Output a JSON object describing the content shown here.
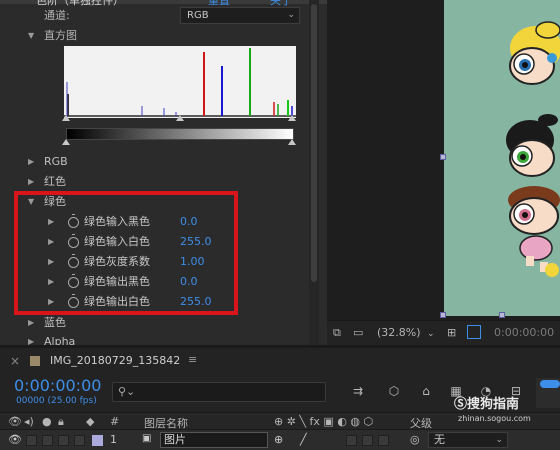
{
  "effect_panel": {
    "header_title": "色阶（单独控件）",
    "header_link": "重置",
    "header_about": "关于",
    "channel_label": "通道:",
    "channel_value": "RGB",
    "histogram_label": "直方图",
    "sections": [
      "RGB",
      "红色",
      "绿色"
    ],
    "green_props": [
      {
        "label": "绿色输入黑色",
        "value": "0.0"
      },
      {
        "label": "绿色输入白色",
        "value": "255.0"
      },
      {
        "label": "绿色灰度系数",
        "value": "1.00"
      },
      {
        "label": "绿色输出黑色",
        "value": "0.0"
      },
      {
        "label": "绿色输出白色",
        "value": "255.0"
      }
    ],
    "after_sections": [
      "蓝色",
      "Alpha"
    ]
  },
  "viewer": {
    "zoom": "(32.8%)",
    "timecode": "0:00:00:00"
  },
  "timeline": {
    "comp_name": "IMG_20180729_135842",
    "menu": "≡",
    "timecode": "0:00:00:00",
    "fps": "00000 (25.00 fps)",
    "search_placeholder": "",
    "columns": {
      "hash": "#",
      "layer_name": "图层名称",
      "parent": "父级"
    },
    "layer": {
      "number": "1",
      "name": "图片",
      "parent": "无"
    }
  },
  "watermark": {
    "brand": "搜狗指南",
    "url": "zhinan.sogou.com"
  },
  "colors": {
    "accent_blue": "#3d8ee8",
    "highlight_red": "#d8151b",
    "canvas_green": "#86b5a2"
  }
}
